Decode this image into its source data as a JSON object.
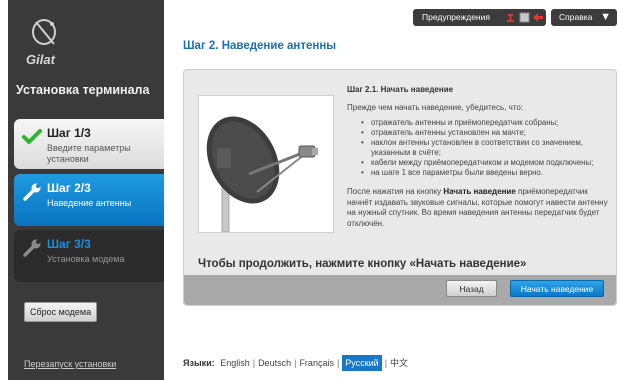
{
  "sidebar": {
    "logo_text": "Gilat",
    "title": "Установка терминала",
    "steps": [
      {
        "title": "Шаг 1/3",
        "desc": "Введите параметры установки"
      },
      {
        "title": "Шаг 2/3",
        "desc": "Наведение антенны"
      },
      {
        "title": "Шаг 3/3",
        "desc": "Установка модема"
      }
    ],
    "reset_button": "Сброс модема",
    "restart_link": "Перезапуск установки"
  },
  "topbar": {
    "alerts_label": "Предупреждения",
    "help_label": "Справка",
    "alert_icon_colors": [
      "#e23a2a",
      "#c0c0c0",
      "#e23a2a"
    ]
  },
  "main": {
    "page_title": "Шаг 2. Наведение антенны",
    "sub_title": "Шаг 2.1. Начать наведение",
    "intro": "Прежде чем начать наведение, убедитесь, что:",
    "checklist": [
      "отражатель антенны и приёмопередатчик собраны;",
      "отражатель антенны установлен на мачте;",
      "наклон антенны установлен в соответствии со значением, указанным в счёте;",
      "кабели между приёмопередатчиком и модемом подключены;",
      "на шаге 1 все параметры были введены верно."
    ],
    "after_prefix": "После нажатия на кнопку ",
    "after_bold": "Начать наведение",
    "after_rest": " приёмопередатчик начнёт издавать звуковые сигналы, которые помогут навести антенну на нужный спутник. Во время наведения антенны передатчик будет отключён.",
    "continue_text": "Чтобы продолжить, нажмите кнопку «Начать наведение»",
    "back_button": "Назад",
    "start_button": "Начать наведение"
  },
  "languages": {
    "label": "Языки:",
    "items": [
      "English",
      "Deutsch",
      "Français",
      "Русский",
      "中文"
    ],
    "active": "Русский"
  },
  "colors": {
    "accent": "#0a78c8",
    "title_blue": "#1a6fb3",
    "sidebar_bg": "#3a3a3a",
    "check_green": "#2db52d"
  }
}
